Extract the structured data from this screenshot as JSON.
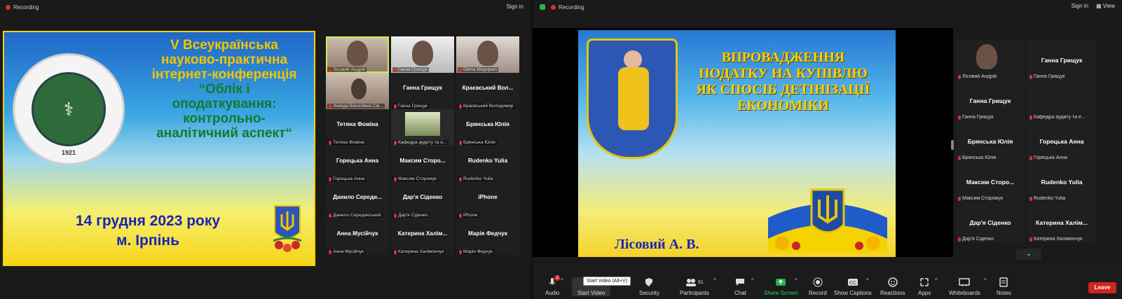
{
  "left": {
    "topbar": {
      "recording": "Recording",
      "sign_in": "Sign in"
    },
    "slide": {
      "seal_year": "1921",
      "conf_line1": "V Всеукраїнська",
      "conf_line2": "науково-практична",
      "conf_line3": "інтернет-конференція",
      "conf_line4": "“Облік і",
      "conf_line5": "оподаткування:",
      "conf_line6": "контрольно-",
      "conf_line7": "аналітичний аспект“",
      "date_line1": "14 грудня 2023 року",
      "date_line2": "м. Ірпінь"
    },
    "tiles": [
      {
        "name": "",
        "label": "Лісовий Андрій",
        "kind": "video-active"
      },
      {
        "name": "",
        "label": "Ганна Грищук",
        "kind": "video2"
      },
      {
        "name": "",
        "label": "Olena Magopets",
        "kind": "video3"
      },
      {
        "name": "",
        "label": "Зінаїда Василівна См...",
        "kind": "video"
      },
      {
        "name": "Ганна Грищук",
        "label": "Ганна Грищук",
        "kind": "name"
      },
      {
        "name": "Краєвський Вол...",
        "label": "Краєвський Володимир",
        "kind": "name"
      },
      {
        "name": "Тетяна Фоміна",
        "label": "Тетяна Фоміна",
        "kind": "name"
      },
      {
        "name": "",
        "label": "Кафедра аудиту та е...",
        "kind": "room"
      },
      {
        "name": "Брянська Юлія",
        "label": "Брянська Юлія",
        "kind": "name"
      },
      {
        "name": "Горецька Анна",
        "label": "Горецька Анна",
        "kind": "name"
      },
      {
        "name": "Максим Сторо...",
        "label": "Максим Сторожук",
        "kind": "name"
      },
      {
        "name": "Rudenko Yulia",
        "label": "Rudenko Yulia",
        "kind": "name"
      },
      {
        "name": "Данило Середи...",
        "label": "Данило Серединський",
        "kind": "name"
      },
      {
        "name": "Дар'я Сіденко",
        "label": "Дар'я Сіденко",
        "kind": "name"
      },
      {
        "name": "iPhone",
        "label": "iPhone",
        "kind": "name"
      },
      {
        "name": "Анна Мусійчук",
        "label": "Анна Мусійчук",
        "kind": "name"
      },
      {
        "name": "Катерина Халім...",
        "label": "Катерина Халімончук",
        "kind": "name"
      },
      {
        "name": "Марія Федчук",
        "label": "Марія Федчук",
        "kind": "name"
      }
    ]
  },
  "right": {
    "topbar": {
      "recording": "Recording",
      "sign_in": "Sign in",
      "view": "View"
    },
    "slide": {
      "title_line1": "ВПРОВАДЖЕННЯ",
      "title_line2": "ПОДАТКУ НА КУПІВЛЮ",
      "title_line3": "ЯК СПОСІБ ДЕТІНІЗАЦІЇ",
      "title_line4": "ЕКОНОМІКИ",
      "author": "Лісовий А. В."
    },
    "tiles": [
      {
        "name": "",
        "label": "Лісовий Андрій",
        "kind": "video-active"
      },
      {
        "name": "Ганна Грищук",
        "label": "Ганна Грищук",
        "kind": "name"
      },
      {
        "name": "Ганна Грищук",
        "label": "Ганна Грищук",
        "kind": "name"
      },
      {
        "name": "",
        "label": "Кафедра аудиту та е...",
        "kind": "room"
      },
      {
        "name": "Брянська Юлія",
        "label": "Брянська Юлія",
        "kind": "name"
      },
      {
        "name": "Горецька Анна",
        "label": "Горецька Анна",
        "kind": "name"
      },
      {
        "name": "Максим Сторо...",
        "label": "Максим Сторожук",
        "kind": "name"
      },
      {
        "name": "Rudenko Yulia",
        "label": "Rudenko Yulia",
        "kind": "name"
      },
      {
        "name": "Дар'я Сіденко",
        "label": "Дар'я Сіденко",
        "kind": "name"
      },
      {
        "name": "Катерина Халім...",
        "label": "Катерина Халімончук",
        "kind": "name"
      }
    ],
    "toolbar": {
      "audio": "Audio",
      "start_video": "Start Video",
      "tooltip": "Start Video (Alt+V)",
      "security": "Security",
      "participants": "Participants",
      "participants_count": "61",
      "chat": "Chat",
      "share_screen": "Share Screen",
      "record": "Record",
      "show_captions": "Show Captions",
      "reactions": "Reactions",
      "apps": "Apps",
      "whiteboards": "Whiteboards",
      "notes": "Notes",
      "leave": "Leave",
      "audio_badge": "1"
    }
  }
}
